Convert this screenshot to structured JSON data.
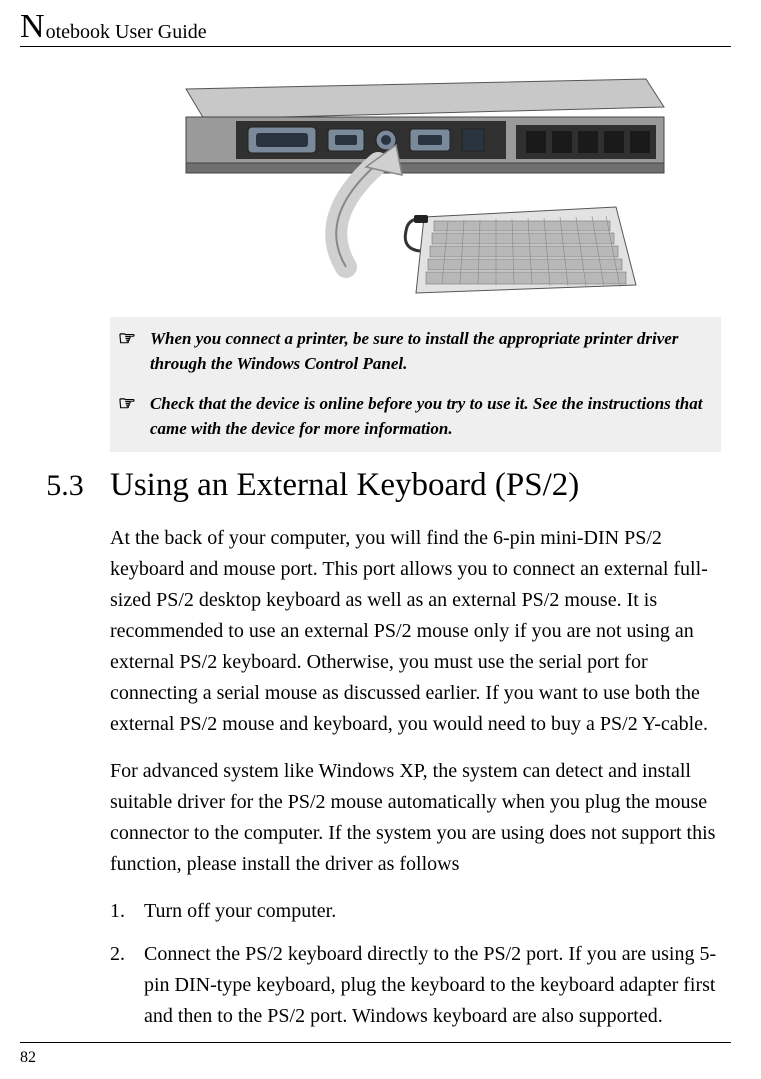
{
  "header": {
    "first_letter": "N",
    "rest": "otebook User Guide"
  },
  "notes": {
    "pointer_glyph": "☞",
    "items": [
      "When you connect a printer, be sure to install the appropriate printer driver through the Windows Control Panel.",
      "Check that the device is online before you try to use it. See the instructions that came with the device for more information."
    ]
  },
  "section": {
    "number": "5.3",
    "title": "Using an External Keyboard (PS/2)"
  },
  "paragraphs": [
    "At the back of your computer, you will find the 6-pin mini-DIN PS/2 keyboard and mouse port. This port allows you to connect an external full-sized PS/2 desktop keyboard as well as an external PS/2 mouse. It is recommended to use an external PS/2 mouse only if you are not using an external PS/2 keyboard. Otherwise, you must use the serial port for connecting a serial mouse as discussed earlier. If you want to use both the external PS/2 mouse and keyboard, you would need to buy a PS/2 Y-cable.",
    "For advanced system like Windows XP, the system can detect and install suitable driver for the PS/2 mouse automatically when you plug the mouse connector to the computer. If the system you are using does not support this function, please install the driver as follows"
  ],
  "steps": [
    {
      "num": "1.",
      "text": "Turn off your computer."
    },
    {
      "num": "2.",
      "text": "Connect the PS/2 keyboard directly to the PS/2 port. If you are using 5-pin DIN-type keyboard, plug the keyboard to the keyboard adapter first and then to the PS/2 port. Windows keyboard are also supported."
    }
  ],
  "page_number": "82"
}
